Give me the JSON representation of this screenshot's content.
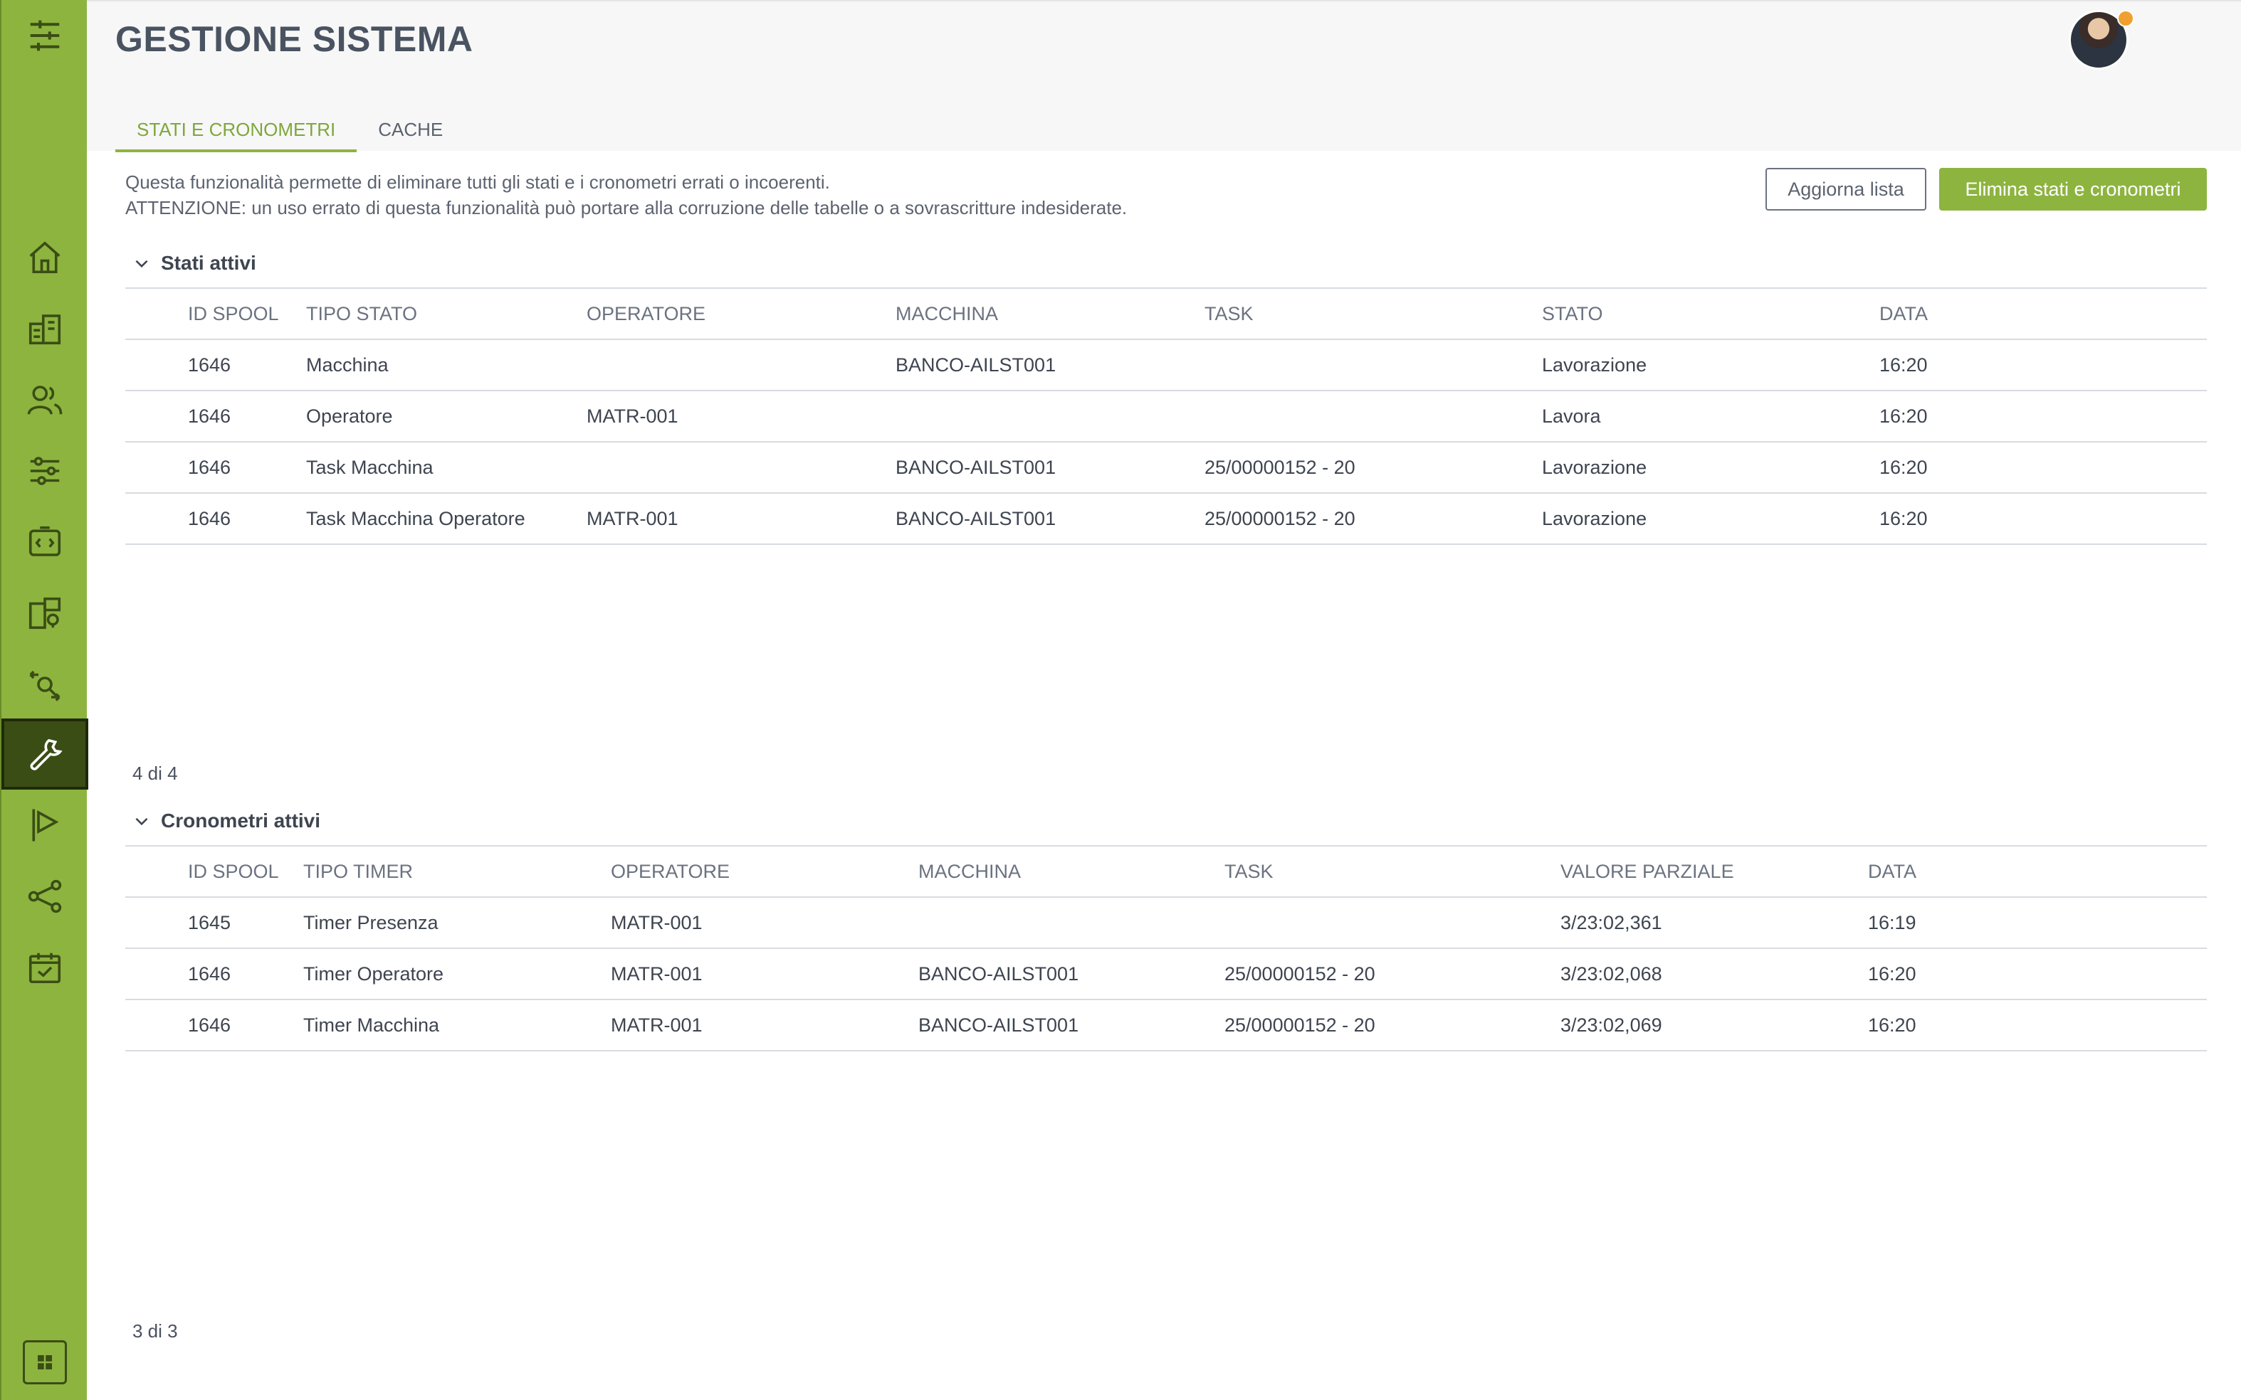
{
  "page": {
    "title": "GESTIONE SISTEMA"
  },
  "tabs": [
    {
      "label": "STATI E CRONOMETRI",
      "active": true
    },
    {
      "label": "CACHE",
      "active": false
    }
  ],
  "info": {
    "line1": "Questa funzionalità permette di eliminare tutti gli stati e i cronometri errati o incoerenti.",
    "line2": "ATTENZIONE: un uso errato di questa funzionalità può portare alla corruzione delle tabelle o a sovrascritture indesiderate."
  },
  "actions": {
    "refresh_label": "Aggiorna lista",
    "delete_label": "Elimina stati e cronometri"
  },
  "sidebar": {
    "items": [
      {
        "icon": "filter-sliders-icon",
        "active": false
      },
      {
        "icon": "home-icon",
        "active": false
      },
      {
        "icon": "building-icon",
        "active": false
      },
      {
        "icon": "users-icon",
        "active": false
      },
      {
        "icon": "settings-sliders-icon",
        "active": false
      },
      {
        "icon": "code-badge-icon",
        "active": false
      },
      {
        "icon": "device-tree-icon",
        "active": false
      },
      {
        "icon": "search-transfer-icon",
        "active": false
      },
      {
        "icon": "wrench-icon",
        "active": true
      },
      {
        "icon": "flag-icon",
        "active": false
      },
      {
        "icon": "share-icon",
        "active": false
      },
      {
        "icon": "calendar-check-icon",
        "active": false
      }
    ],
    "bottom_icon": "grid-icon"
  },
  "states": {
    "title": "Stati attivi",
    "columns": [
      "ID SPOOL",
      "TIPO STATO",
      "OPERATORE",
      "MACCHINA",
      "TASK",
      "STATO",
      "DATA"
    ],
    "rows": [
      [
        "1646",
        "Macchina",
        "",
        "BANCO-AILST001",
        "",
        "Lavorazione",
        "16:20"
      ],
      [
        "1646",
        "Operatore",
        "MATR-001",
        "",
        "",
        "Lavora",
        "16:20"
      ],
      [
        "1646",
        "Task Macchina",
        "",
        "BANCO-AILST001",
        "25/00000152 - 20",
        "Lavorazione",
        "16:20"
      ],
      [
        "1646",
        "Task Macchina Operatore",
        "MATR-001",
        "BANCO-AILST001",
        "25/00000152 - 20",
        "Lavorazione",
        "16:20"
      ]
    ],
    "counter": "4 di 4"
  },
  "timers": {
    "title": "Cronometri attivi",
    "columns": [
      "ID SPOOL",
      "TIPO TIMER",
      "OPERATORE",
      "MACCHINA",
      "TASK",
      "VALORE PARZIALE",
      "DATA"
    ],
    "rows": [
      [
        "1645",
        "Timer Presenza",
        "MATR-001",
        "",
        "",
        "3/23:02,361",
        "16:19"
      ],
      [
        "1646",
        "Timer Operatore",
        "MATR-001",
        "BANCO-AILST001",
        "25/00000152 - 20",
        "3/23:02,068",
        "16:20"
      ],
      [
        "1646",
        "Timer Macchina",
        "MATR-001",
        "BANCO-AILST001",
        "25/00000152 - 20",
        "3/23:02,069",
        "16:20"
      ]
    ],
    "counter": "3 di 3"
  },
  "colors": {
    "accent": "#8db43f",
    "sidebar_active": "#3a4d15"
  }
}
